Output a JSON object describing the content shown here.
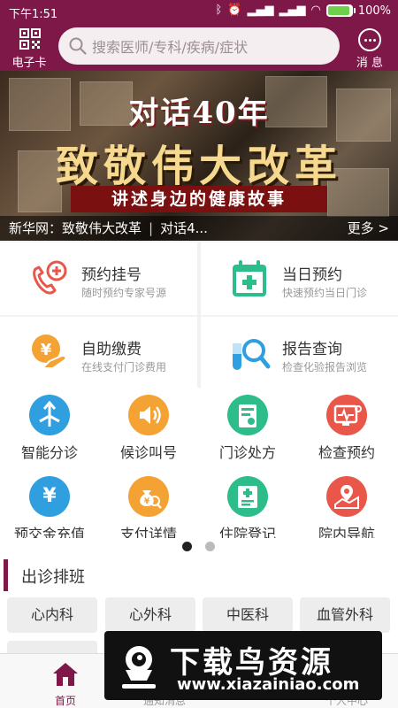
{
  "status_bar": {
    "time": "下午1:51",
    "battery": "100%"
  },
  "topbar": {
    "card_label": "电子卡",
    "search_placeholder": "搜索医师/专科/疾病/症状",
    "message_label": "消 息"
  },
  "banner": {
    "line1": "对话40年",
    "line2": "致敬伟大改革",
    "line3": "讲述身边的健康故事",
    "caption": "新华网：致敬伟大改革",
    "caption_next": "对话4...",
    "more": "更多 >"
  },
  "services": [
    {
      "title": "预约挂号",
      "sub": "随时预约专家号源",
      "icon": "phone-plus-icon",
      "color": "#e8574a"
    },
    {
      "title": "当日预约",
      "sub": "快速预约当日门诊",
      "icon": "calendar-cross-icon",
      "color": "#2dbd8a"
    },
    {
      "title": "自助缴费",
      "sub": "在线支付门诊费用",
      "icon": "yuan-hand-icon",
      "color": "#f4a233"
    },
    {
      "title": "报告查询",
      "sub": "检查化验报告浏览",
      "icon": "test-tube-search-icon",
      "color": "#2f9fe0"
    }
  ],
  "grid": [
    {
      "label": "智能分诊",
      "icon": "split-arrows-icon",
      "color": "#2f9fe0"
    },
    {
      "label": "候诊叫号",
      "icon": "speaker-icon",
      "color": "#f4a233"
    },
    {
      "label": "门诊处方",
      "icon": "prescription-icon",
      "color": "#2dbd8a"
    },
    {
      "label": "检查预约",
      "icon": "monitor-stethoscope-icon",
      "color": "#e8574a"
    },
    {
      "label": "预交金充值",
      "icon": "yuan-circle-icon",
      "color": "#2f9fe0"
    },
    {
      "label": "支付详情",
      "icon": "money-bag-search-icon",
      "color": "#f4a233"
    },
    {
      "label": "住院登记",
      "icon": "hospital-register-icon",
      "color": "#2dbd8a"
    },
    {
      "label": "院内导航",
      "icon": "map-pin-icon",
      "color": "#e8574a"
    }
  ],
  "schedule": {
    "title": "出诊排班",
    "departments": [
      "心内科",
      "心外科",
      "中医科",
      "血管外科"
    ]
  },
  "bottom_nav": [
    {
      "label": "首页",
      "active": true
    },
    {
      "label": "通知消息",
      "active": false
    },
    {
      "label": "",
      "active": false
    },
    {
      "label": "个人中心",
      "active": false
    }
  ],
  "watermark": {
    "text": "下载鸟资源",
    "url": "www.xiazainiao.com"
  },
  "colors": {
    "brand": "#7d1848",
    "accent_red": "#e8574a",
    "accent_green": "#2dbd8a",
    "accent_orange": "#f4a233",
    "accent_blue": "#2f9fe0"
  }
}
